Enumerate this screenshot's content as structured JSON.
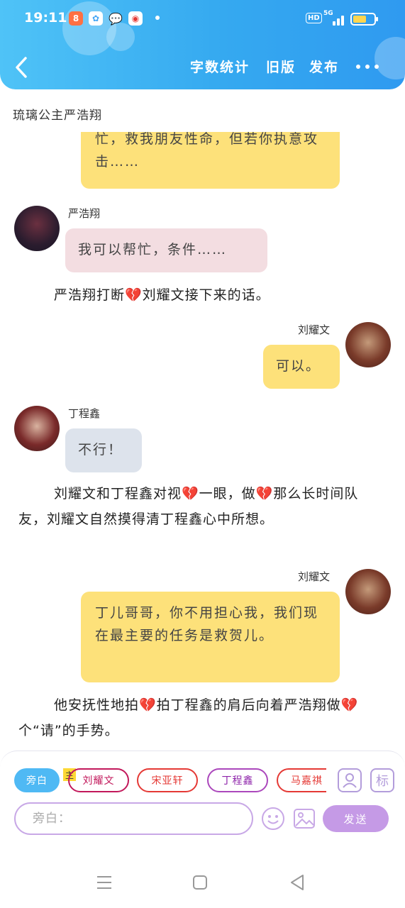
{
  "status_bar": {
    "time": "19:11",
    "network": "5G",
    "hd_label": "HD"
  },
  "header": {
    "buttons": [
      "字数统计",
      "旧版",
      "发布"
    ]
  },
  "story_title": "琉璃公主严浩翔",
  "messages": [
    {
      "type": "bubble_partial",
      "text": "忙，救我朋友性命，但若你执意攻击……"
    },
    {
      "type": "left",
      "speaker": "严浩翔",
      "text": "我可以帮忙，条件……"
    },
    {
      "type": "narration",
      "text": "严浩翔打断💔刘耀文接下来的话。"
    },
    {
      "type": "right",
      "speaker": "刘耀文",
      "text": "可以。"
    },
    {
      "type": "left",
      "speaker": "丁程鑫",
      "text": "不行！"
    },
    {
      "type": "narration",
      "text": "刘耀文和丁程鑫对视💔一眼，做💔那么长时间队友，刘耀文自然摸得清丁程鑫心中所想。"
    },
    {
      "type": "right",
      "speaker": "刘耀文",
      "text": "丁儿哥哥，你不用担心我，我们现在最主要的任务是救贺儿。"
    },
    {
      "type": "narration",
      "text": "他安抚性地拍💔拍丁程鑫的肩后向着严浩翔做💔个“请”的手势。"
    }
  ],
  "composer": {
    "role_chips": [
      "旁白",
      "刘耀文",
      "宋亚轩",
      "丁程鑫",
      "马嘉祺"
    ],
    "main_tag": "主",
    "input_placeholder": "旁白：",
    "send_label": "发送",
    "tag_label": "标"
  },
  "colors": {
    "header": "#35a9f0",
    "bubble_yellow": "#fde17a",
    "bubble_pink": "#f3dde1",
    "bubble_gray": "#dde3ec",
    "accent_purple": "#c59ae6"
  }
}
